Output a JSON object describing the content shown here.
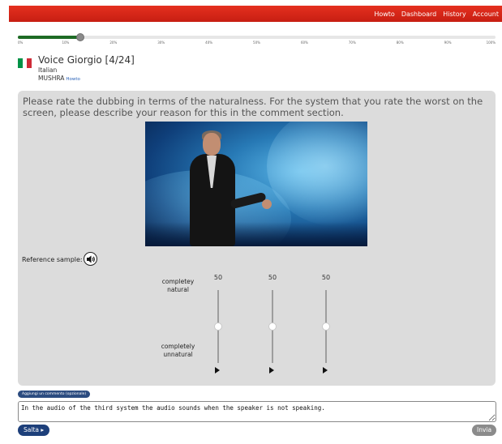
{
  "nav": {
    "items": [
      "Howto",
      "Dashboard",
      "History",
      "Account"
    ],
    "bar_color": "#d42a1a"
  },
  "progress": {
    "value_percent": 13,
    "ticks": [
      "0%",
      "10%",
      "20%",
      "30%",
      "40%",
      "50%",
      "60%",
      "70%",
      "80%",
      "90%",
      "100%"
    ],
    "fill_color": "#1e6b25"
  },
  "task": {
    "title": "Voice Giorgio [4/24]",
    "language": "Italian",
    "method": "MUSHRA",
    "howto_link": "Howto",
    "flag_colors": [
      "#009246",
      "#ffffff",
      "#ce2b37"
    ]
  },
  "panel": {
    "instruction": "Please rate the dubbing in terms of the naturalness. For the system that you rate the worst on the screen, please describe your reason for this in the comment section.",
    "reference_label": "Reference sample:",
    "scale_top_label": "completey natural",
    "scale_bottom_label": "completely unnatural",
    "sliders": [
      {
        "value": "50",
        "level": 50
      },
      {
        "value": "50",
        "level": 50
      },
      {
        "value": "50",
        "level": 50
      }
    ]
  },
  "comment": {
    "toggle_label": "Aggiungi un commento (opzionale)",
    "text": "In the audio of the third system the audio sounds when the speaker is not speaking."
  },
  "actions": {
    "skip_label": "Salta ▸",
    "submit_label": "Invia"
  }
}
